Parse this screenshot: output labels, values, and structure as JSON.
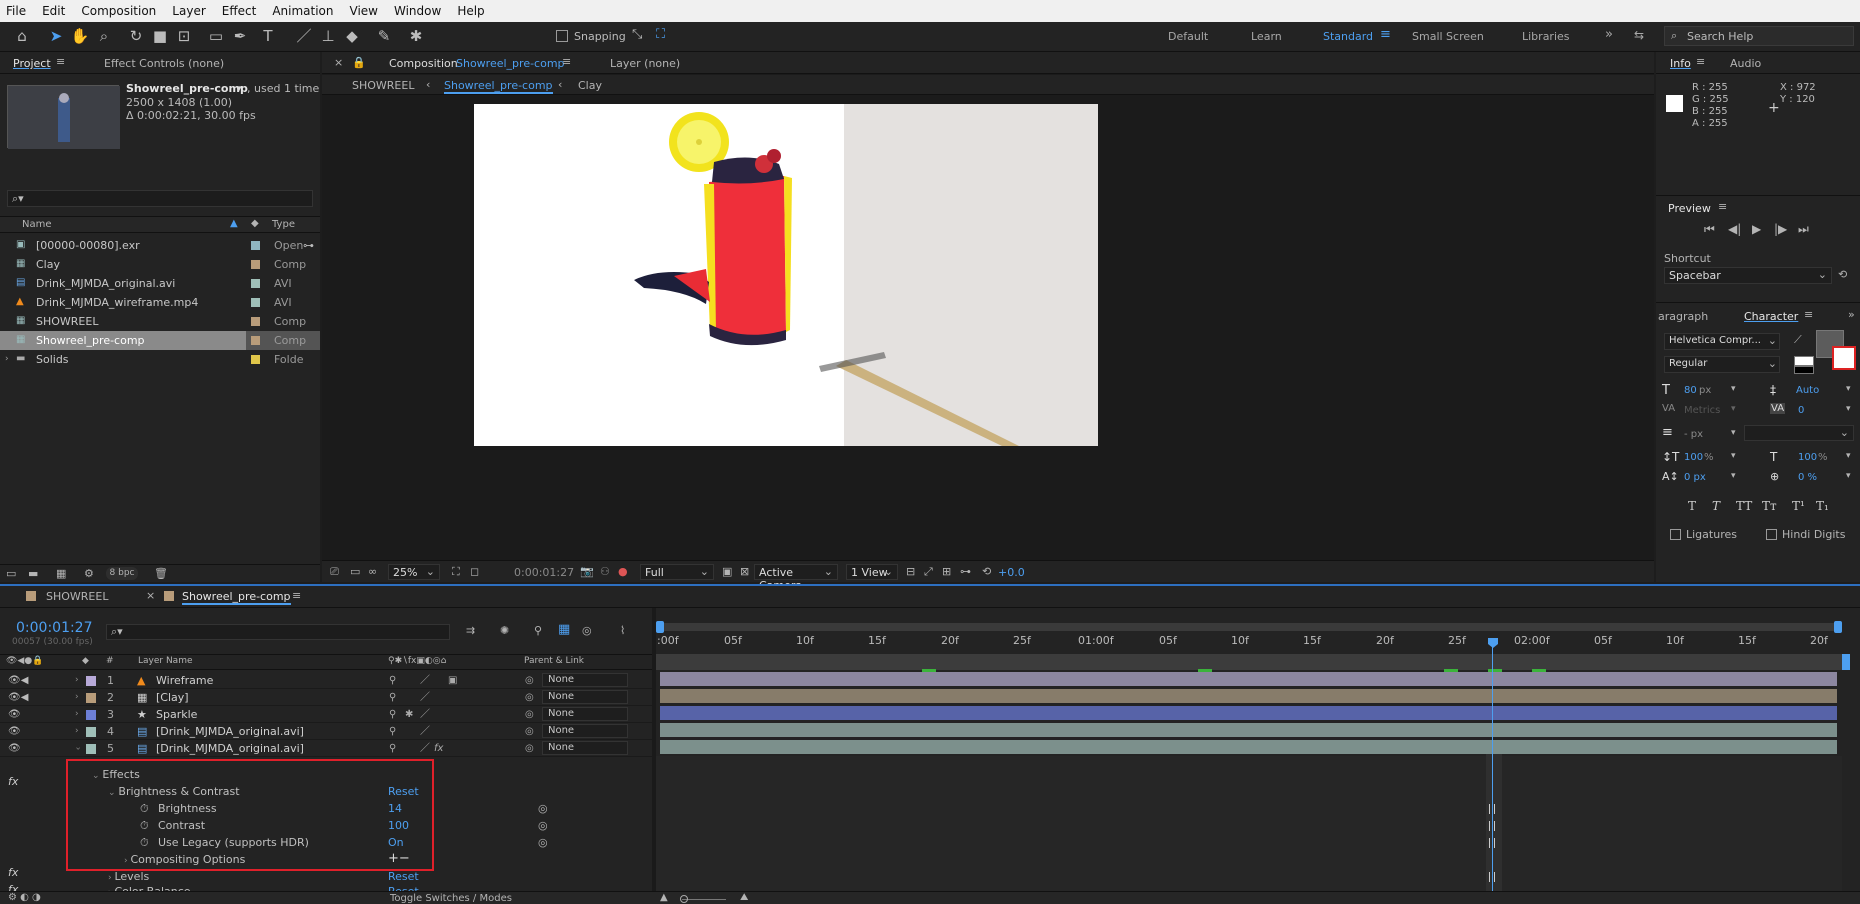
{
  "menu": [
    "File",
    "Edit",
    "Composition",
    "Layer",
    "Effect",
    "Animation",
    "View",
    "Window",
    "Help"
  ],
  "toolbar": {
    "snapping": "Snapping",
    "workspaces": [
      "Default",
      "Learn",
      "Standard",
      "Small Screen",
      "Libraries"
    ],
    "active_workspace": "Standard",
    "search_placeholder": "Search Help"
  },
  "project_panel": {
    "tab_project": "Project",
    "tab_effect_controls": "Effect Controls (none)",
    "selected_name": "Showreel_pre-comp",
    "used": ", used 1 time",
    "dims": "2500 x 1408 (1.00)",
    "duration": "Δ 0:00:02:21, 30.00 fps",
    "col_name": "Name",
    "col_type": "Type",
    "items": [
      {
        "name": "[00000-00080].exr",
        "type": "Open",
        "color": "#8fb5c0",
        "icon": "image-sequence-icon"
      },
      {
        "name": "Clay",
        "type": "Comp",
        "color": "#b89c7a",
        "icon": "composition-icon"
      },
      {
        "name": "Drink_MJMDA_original.avi",
        "type": "AVI",
        "color": "#9fbfb8",
        "icon": "video-file-icon"
      },
      {
        "name": "Drink_MJMDA_wireframe.mp4",
        "type": "AVI",
        "color": "#9fbfb8",
        "icon": "vlc-cone-icon"
      },
      {
        "name": "SHOWREEL",
        "type": "Comp",
        "color": "#b89c7a",
        "icon": "composition-icon"
      },
      {
        "name": "Showreel_pre-comp",
        "type": "Comp",
        "color": "#b89c7a",
        "icon": "composition-icon"
      },
      {
        "name": "Solids",
        "type": "Folde",
        "color": "#e0c64a",
        "icon": "folder-icon"
      }
    ],
    "bpc": "8 bpc"
  },
  "comp_panel": {
    "tab_label": "Composition",
    "tab_comp": "Showreel_pre-comp",
    "layer_tab": "Layer (none)",
    "breadcrumbs": [
      "SHOWREEL",
      "Showreel_pre-comp",
      "Clay"
    ],
    "zoom": "25%",
    "timecode": "0:00:01:27",
    "resolution": "Full",
    "camera": "Active Camera",
    "views": "1 View",
    "exposure": "+0.0"
  },
  "info_panel": {
    "tab_info": "Info",
    "tab_audio": "Audio",
    "r": "R : 255",
    "g": "G : 255",
    "b": "B : 255",
    "a": "A : 255",
    "x": "X : 972",
    "y": "Y : 120"
  },
  "preview_panel": {
    "title": "Preview",
    "shortcut_label": "Shortcut",
    "shortcut_value": "Spacebar"
  },
  "character_panel": {
    "tab_paragraph": "aragraph",
    "tab_character": "Character",
    "font": "Helvetica Compr...",
    "style": "Regular",
    "size": "80",
    "size_unit": "px",
    "leading": "Auto",
    "kerning": "Metrics",
    "tracking": "0",
    "stroke": "- px",
    "vscale": "100",
    "hscale": "100",
    "baseline": "0 px",
    "tsume": "0 %",
    "pct": "%",
    "ligatures": "Ligatures",
    "hindi": "Hindi Digits",
    "styles": [
      "T",
      "T",
      "TT",
      "Tт",
      "T¹",
      "T₁"
    ]
  },
  "timeline": {
    "tabs": [
      "SHOWREEL",
      "Showreel_pre-comp"
    ],
    "timecode": "0:00:01:27",
    "frames": "00057 (30.00 fps)",
    "col_layer_name": "Layer Name",
    "col_parent": "Parent & Link",
    "col_hash": "#",
    "ticks": [
      ":00f",
      "05f",
      "10f",
      "15f",
      "20f",
      "25f",
      "01:00f",
      "05f",
      "10f",
      "15f",
      "20f",
      "25f",
      "02:00f",
      "05f",
      "10f",
      "15f",
      "20f"
    ],
    "layers": [
      {
        "num": "1",
        "name": "Wireframe",
        "icon": "vlc-cone-icon",
        "color": "#b7a9d8",
        "parent": "None"
      },
      {
        "num": "2",
        "name": "[Clay]",
        "icon": "composition-icon",
        "color": "#b89c7a",
        "parent": "None"
      },
      {
        "num": "3",
        "name": "Sparkle",
        "icon": "star-icon",
        "color": "#6d7fd6",
        "parent": "None"
      },
      {
        "num": "4",
        "name": "[Drink_MJMDA_original.avi]",
        "icon": "video-file-icon",
        "color": "#9fbfb8",
        "parent": "None"
      },
      {
        "num": "5",
        "name": "[Drink_MJMDA_original.avi]",
        "icon": "video-file-icon",
        "color": "#9fbfb8",
        "parent": "None"
      }
    ],
    "effects_label": "Effects",
    "bc_name": "Brightness & Contrast",
    "reset": "Reset",
    "brightness_label": "Brightness",
    "brightness_value": "14",
    "contrast_label": "Contrast",
    "contrast_value": "100",
    "legacy_label": "Use Legacy (supports HDR)",
    "legacy_value": "On",
    "compositing_label": "Compositing Options",
    "levels_label": "Levels",
    "color_balance_label": "Color Balance",
    "toggle_label": "Toggle Switches / Modes"
  }
}
